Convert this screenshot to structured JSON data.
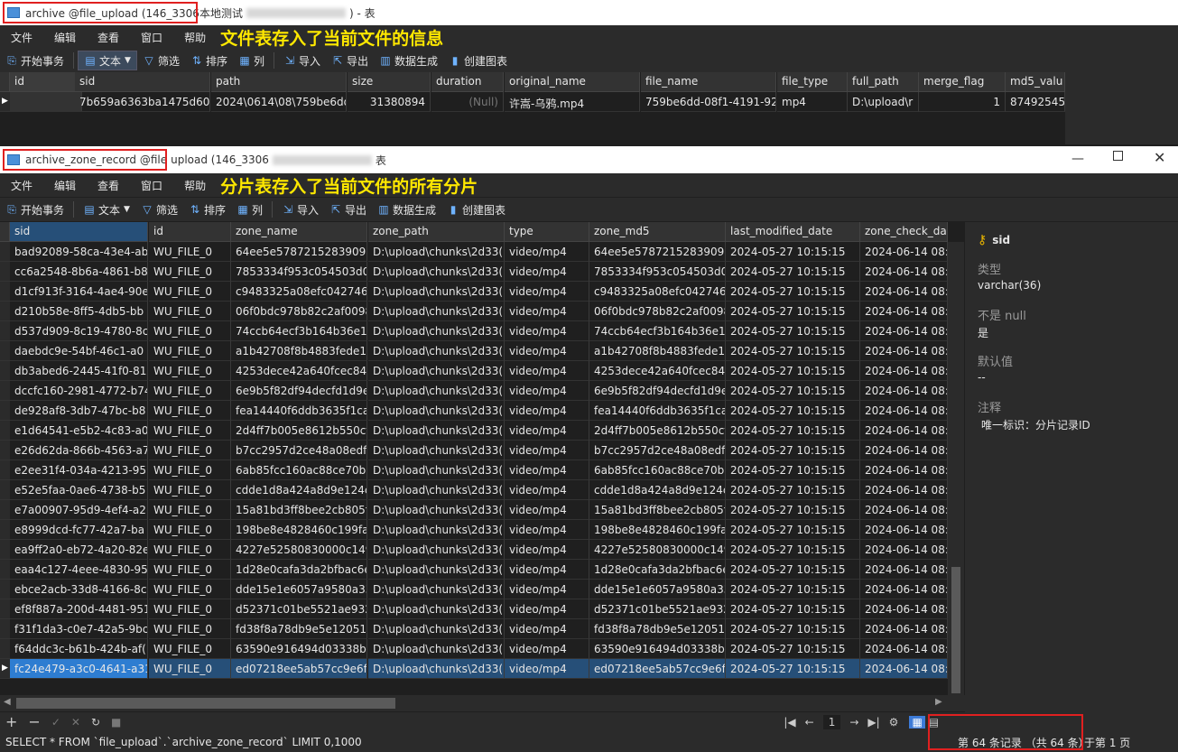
{
  "window1": {
    "title": "archive @file_upload (146_3306本地测试",
    "title_suffix": ") - 表",
    "menu": [
      "文件",
      "编辑",
      "查看",
      "窗口",
      "帮助"
    ],
    "annotation": "文件表存入了当前文件的信息",
    "toolbar": {
      "begin_tx": "开始事务",
      "text": "文本",
      "filter": "筛选",
      "sort": "排序",
      "column": "列",
      "import": "导入",
      "export": "导出",
      "datagen": "数据生成",
      "chart": "创建图表"
    },
    "columns": [
      "id",
      "sid",
      "path",
      "size",
      "duration",
      "original_name",
      "file_name",
      "file_type",
      "full_path",
      "merge_flag",
      "md5_valu"
    ],
    "row": [
      "",
      "7b659a6363ba1475d603",
      "2024\\0614\\08\\759be6dd",
      "31380894",
      "(Null)",
      "许嵩-乌鸦.mp4",
      "759be6dd-08f1-4191-92",
      "mp4",
      "D:\\upload\\r",
      "1",
      "874925459"
    ]
  },
  "window2": {
    "title_a": "archive_zone_record @file",
    "title_b": "upload (146_3306",
    "title_suffix": "表",
    "menu": [
      "文件",
      "编辑",
      "查看",
      "窗口",
      "帮助"
    ],
    "annotation": "分片表存入了当前文件的所有分片",
    "toolbar": {
      "begin_tx": "开始事务",
      "text": "文本",
      "filter": "筛选",
      "sort": "排序",
      "column": "列",
      "import": "导入",
      "export": "导出",
      "datagen": "数据生成",
      "chart": "创建图表"
    },
    "columns": [
      "sid",
      "id",
      "zone_name",
      "zone_path",
      "type",
      "zone_md5",
      "last_modified_date",
      "zone_check_da"
    ],
    "rows": [
      [
        "bad92089-58ca-43e4-ab",
        "WU_FILE_0",
        "64ee5e5787215283909a",
        "D:\\upload\\chunks\\2d33(",
        "video/mp4",
        "64ee5e5787215283909a",
        "2024-05-27 10:15:15",
        "2024-06-14 08:4"
      ],
      [
        "cc6a2548-8b6a-4861-b8",
        "WU_FILE_0",
        "7853334f953c054503d0(",
        "D:\\upload\\chunks\\2d33(",
        "video/mp4",
        "7853334f953c054503d0(",
        "2024-05-27 10:15:15",
        "2024-06-14 08:4"
      ],
      [
        "d1cf913f-3164-4ae4-90e",
        "WU_FILE_0",
        "c9483325a08efc0427461",
        "D:\\upload\\chunks\\2d33(",
        "video/mp4",
        "c9483325a08efc0427461",
        "2024-05-27 10:15:15",
        "2024-06-14 08:4"
      ],
      [
        "d210b58e-8ff5-4db5-bb",
        "WU_FILE_0",
        "06f0bdc978b82c2af0098",
        "D:\\upload\\chunks\\2d33(",
        "video/mp4",
        "06f0bdc978b82c2af0098",
        "2024-05-27 10:15:15",
        "2024-06-14 08:4"
      ],
      [
        "d537d909-8c19-4780-8c",
        "WU_FILE_0",
        "74ccb64ecf3b164b36e1l",
        "D:\\upload\\chunks\\2d33(",
        "video/mp4",
        "74ccb64ecf3b164b36e1l",
        "2024-05-27 10:15:15",
        "2024-06-14 08:4"
      ],
      [
        "daebdc9e-54bf-46c1-a0",
        "WU_FILE_0",
        "a1b42708f8b4883fede1f",
        "D:\\upload\\chunks\\2d33(",
        "video/mp4",
        "a1b42708f8b4883fede1f",
        "2024-05-27 10:15:15",
        "2024-06-14 08:4"
      ],
      [
        "db3abed6-2445-41f0-81",
        "WU_FILE_0",
        "4253dece42a640fcec840",
        "D:\\upload\\chunks\\2d33(",
        "video/mp4",
        "4253dece42a640fcec840",
        "2024-05-27 10:15:15",
        "2024-06-14 08:4"
      ],
      [
        "dccfc160-2981-4772-b74",
        "WU_FILE_0",
        "6e9b5f82df94decfd1d9e",
        "D:\\upload\\chunks\\2d33(",
        "video/mp4",
        "6e9b5f82df94decfd1d9e",
        "2024-05-27 10:15:15",
        "2024-06-14 08:4"
      ],
      [
        "de928af8-3db7-47bc-b8",
        "WU_FILE_0",
        "fea14440f6ddb3635f1ca",
        "D:\\upload\\chunks\\2d33(",
        "video/mp4",
        "fea14440f6ddb3635f1ca",
        "2024-05-27 10:15:15",
        "2024-06-14 08:4"
      ],
      [
        "e1d64541-e5b2-4c83-a0",
        "WU_FILE_0",
        "2d4ff7b005e8612b550cf",
        "D:\\upload\\chunks\\2d33(",
        "video/mp4",
        "2d4ff7b005e8612b550cf",
        "2024-05-27 10:15:15",
        "2024-06-14 08:4"
      ],
      [
        "e26d62da-866b-4563-a7",
        "WU_FILE_0",
        "b7cc2957d2ce48a08edf8",
        "D:\\upload\\chunks\\2d33(",
        "video/mp4",
        "b7cc2957d2ce48a08edf8",
        "2024-05-27 10:15:15",
        "2024-06-14 08:4"
      ],
      [
        "e2ee31f4-034a-4213-95(",
        "WU_FILE_0",
        "6ab85fcc160ac88ce70b0",
        "D:\\upload\\chunks\\2d33(",
        "video/mp4",
        "6ab85fcc160ac88ce70b0",
        "2024-05-27 10:15:15",
        "2024-06-14 08:4"
      ],
      [
        "e52e5faa-0ae6-4738-b5",
        "WU_FILE_0",
        "cdde1d8a424a8d9e124c",
        "D:\\upload\\chunks\\2d33(",
        "video/mp4",
        "cdde1d8a424a8d9e124c",
        "2024-05-27 10:15:15",
        "2024-06-14 08:4"
      ],
      [
        "e7a00907-95d9-4ef4-a2",
        "WU_FILE_0",
        "15a81bd3ff8bee2cb805f",
        "D:\\upload\\chunks\\2d33(",
        "video/mp4",
        "15a81bd3ff8bee2cb805f",
        "2024-05-27 10:15:15",
        "2024-06-14 08:4"
      ],
      [
        "e8999dcd-fc77-42a7-ba",
        "WU_FILE_0",
        "198be8e4828460c199fa5",
        "D:\\upload\\chunks\\2d33(",
        "video/mp4",
        "198be8e4828460c199fa5",
        "2024-05-27 10:15:15",
        "2024-06-14 08:4"
      ],
      [
        "ea9ff2a0-eb72-4a20-82e",
        "WU_FILE_0",
        "4227e52580830000c149",
        "D:\\upload\\chunks\\2d33(",
        "video/mp4",
        "4227e52580830000c149",
        "2024-05-27 10:15:15",
        "2024-06-14 08:4"
      ],
      [
        "eaa4c127-4eee-4830-95",
        "WU_FILE_0",
        "1d28e0cafa3da2bfbac6e",
        "D:\\upload\\chunks\\2d33(",
        "video/mp4",
        "1d28e0cafa3da2bfbac6e",
        "2024-05-27 10:15:15",
        "2024-06-14 08:4"
      ],
      [
        "ebce2acb-33d8-4166-8c",
        "WU_FILE_0",
        "dde15e1e6057a9580a33",
        "D:\\upload\\chunks\\2d33(",
        "video/mp4",
        "dde15e1e6057a9580a33",
        "2024-05-27 10:15:15",
        "2024-06-14 08:4"
      ],
      [
        "ef8f887a-200d-4481-951",
        "WU_FILE_0",
        "d52371c01be5521ae932",
        "D:\\upload\\chunks\\2d33(",
        "video/mp4",
        "d52371c01be5521ae932",
        "2024-05-27 10:15:15",
        "2024-06-14 08:4"
      ],
      [
        "f31f1da3-c0e7-42a5-9bc",
        "WU_FILE_0",
        "fd38f8a78db9e5e12051f",
        "D:\\upload\\chunks\\2d33(",
        "video/mp4",
        "fd38f8a78db9e5e12051f",
        "2024-05-27 10:15:15",
        "2024-06-14 08:4"
      ],
      [
        "f64ddc3c-b61b-424b-af(",
        "WU_FILE_0",
        "63590e916494d03338b9",
        "D:\\upload\\chunks\\2d33(",
        "video/mp4",
        "63590e916494d03338b9",
        "2024-05-27 10:15:15",
        "2024-06-14 08:4"
      ],
      [
        "fc24e479-a3c0-4641-a31",
        "WU_FILE_0",
        "ed07218ee5ab57cc9e6f",
        "D:\\upload\\chunks\\2d33(",
        "video/mp4",
        "ed07218ee5ab57cc9e6f",
        "2024-05-27 10:15:15",
        "2024-06-14 08:4"
      ]
    ],
    "selected_row": 21,
    "side": {
      "field": "sid",
      "type_label": "类型",
      "type_value": "varchar(36)",
      "notnull_label": "不是 null",
      "notnull_value": "是",
      "default_label": "默认值",
      "default_value": "--",
      "comment_label": "注释",
      "comment_value": "唯一标识：分片记录ID"
    },
    "page_number": "1",
    "sql": "SELECT * FROM `file_upload`.`archive_zone_record` LIMIT 0,1000",
    "records": "第 64 条记录 （共 64 条）",
    "page_text": "于第 1 页"
  },
  "colors": {
    "accent": "#264f78",
    "annotation": "#ffe800",
    "highlight_box": "#e02020"
  }
}
